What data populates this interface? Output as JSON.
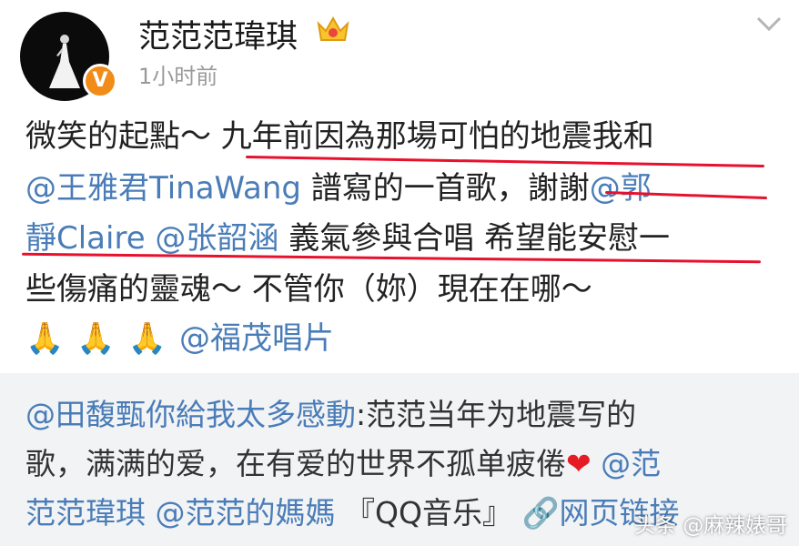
{
  "post": {
    "username": "范范范瑋琪",
    "time": "1小时前",
    "verified_badge": "V",
    "icons": [
      "avatar",
      "verified-badge-icon",
      "crown-icon",
      "chevron-down-icon"
    ],
    "line1": "微笑的起點～ 九年前因為那場可怕的地震我和",
    "line2_mention": "@王雅君TinaWang",
    "line2_text": " 譜寫的一首歌，謝謝",
    "line2_mention2": "@郭",
    "line3_mention": "靜Claire @张韶涵",
    "line3_text": " 義氣參與合唱 希望能安慰一",
    "line4": "些傷痛的靈魂～ 不管你（妳）現在在哪～",
    "line5_mention": "@福茂唱片",
    "pray_emoji": "🙏",
    "underline_color": "#e8112d",
    "mention_color": "#4a7db8"
  },
  "repost": {
    "line1_mention": "@田馥甄你給我太多感動",
    "line1_text": ":范范当年为地震写的",
    "line2_text": "歌，满满的爱，在有爱的世界不孤单疲倦",
    "heart": "❤",
    "line2_mention": " @范",
    "line3_mention": "范范瑋琪 @范范的媽媽",
    "line3_text": " 『QQ音乐』",
    "link_icon": "🔗",
    "link_text": "网页链接"
  },
  "watermark": "头条 @麻辣婊哥"
}
